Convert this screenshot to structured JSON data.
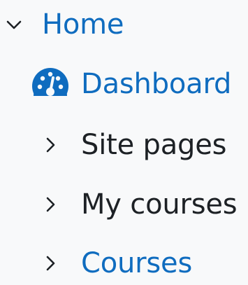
{
  "nav": {
    "home": {
      "label": "Home",
      "icon": "chevron-down-icon"
    },
    "dashboard": {
      "label": "Dashboard",
      "icon": "tachometer-icon"
    },
    "site_pages": {
      "label": "Site pages",
      "icon": "chevron-right-icon"
    },
    "my_courses": {
      "label": "My courses",
      "icon": "chevron-right-icon"
    },
    "courses": {
      "label": "Courses",
      "icon": "chevron-right-icon"
    }
  },
  "colors": {
    "link": "#0f6cbf",
    "text": "#1d2125",
    "background": "#f8f9fa"
  }
}
